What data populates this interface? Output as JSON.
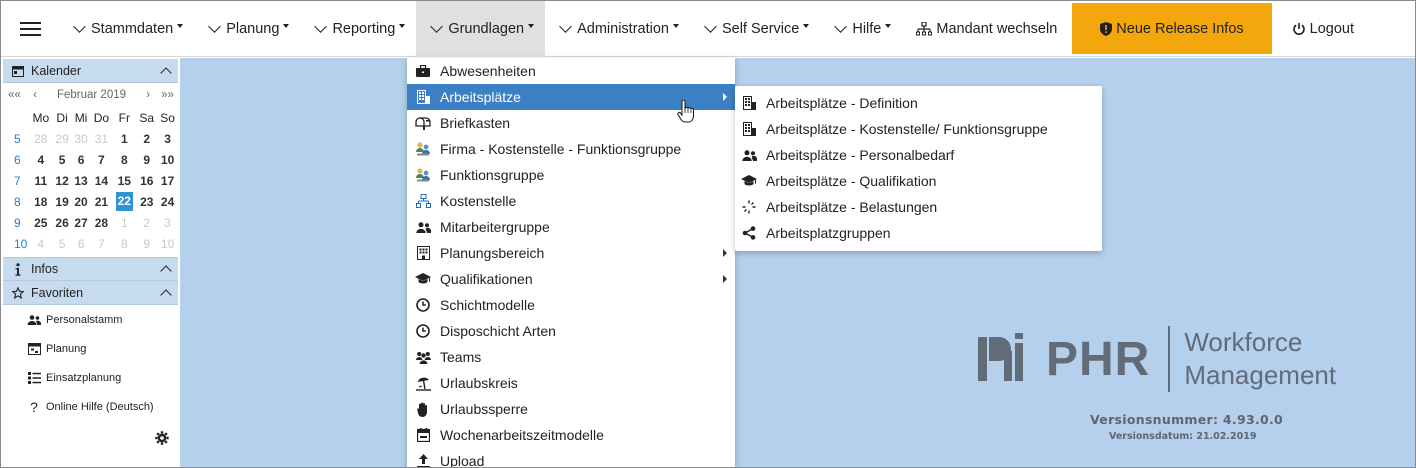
{
  "topnav": {
    "menu_icon": "hamburger-icon",
    "items": [
      {
        "label": "Stammdaten"
      },
      {
        "label": "Planung"
      },
      {
        "label": "Reporting"
      },
      {
        "label": "Grundlagen"
      },
      {
        "label": "Administration"
      },
      {
        "label": "Self Service"
      },
      {
        "label": "Hilfe"
      }
    ],
    "mandant": "Mandant wechseln",
    "release": "Neue Release Infos",
    "logout": "Logout"
  },
  "sidebar": {
    "calendar": {
      "title": "Kalender",
      "nav": {
        "first": "««",
        "prev": "‹",
        "month": "Februar 2019",
        "next": "›",
        "last": "»»"
      },
      "weekdays": [
        "Mo",
        "Di",
        "Mi",
        "Do",
        "Fr",
        "Sa",
        "So"
      ],
      "weeks": [
        {
          "wk": "5",
          "days": [
            "28",
            "29",
            "30",
            "31",
            "1",
            "2",
            "3"
          ],
          "other": [
            true,
            true,
            true,
            true,
            false,
            false,
            false
          ]
        },
        {
          "wk": "6",
          "days": [
            "4",
            "5",
            "6",
            "7",
            "8",
            "9",
            "10"
          ],
          "other": [
            false,
            false,
            false,
            false,
            false,
            false,
            false
          ]
        },
        {
          "wk": "7",
          "days": [
            "11",
            "12",
            "13",
            "14",
            "15",
            "16",
            "17"
          ],
          "other": [
            false,
            false,
            false,
            false,
            false,
            false,
            false
          ]
        },
        {
          "wk": "8",
          "days": [
            "18",
            "19",
            "20",
            "21",
            "22",
            "23",
            "24"
          ],
          "other": [
            false,
            false,
            false,
            false,
            false,
            false,
            false
          ]
        },
        {
          "wk": "9",
          "days": [
            "25",
            "26",
            "27",
            "28",
            "1",
            "2",
            "3"
          ],
          "other": [
            false,
            false,
            false,
            false,
            true,
            true,
            true
          ]
        },
        {
          "wk": "10",
          "days": [
            "4",
            "5",
            "6",
            "7",
            "8",
            "9",
            "10"
          ],
          "other": [
            true,
            true,
            true,
            true,
            true,
            true,
            true
          ]
        }
      ],
      "today": "22"
    },
    "infos": {
      "title": "Infos"
    },
    "favoriten": {
      "title": "Favoriten",
      "items": [
        {
          "label": "Personalstamm",
          "icon": "users-icon"
        },
        {
          "label": "Planung",
          "icon": "calendar-plan-icon"
        },
        {
          "label": "Einsatzplanung",
          "icon": "list-icon"
        },
        {
          "label": "Online Hilfe (Deutsch)",
          "icon": "question-icon"
        }
      ]
    }
  },
  "menu": {
    "items": [
      {
        "label": "Abwesenheiten",
        "icon": "briefcase-icon"
      },
      {
        "label": "Arbeitsplätze",
        "icon": "building-icon",
        "selected": true,
        "submenu": true
      },
      {
        "label": "Briefkasten",
        "icon": "mailbox-icon"
      },
      {
        "label": "Firma - Kostenstelle - Funktionsgruppe",
        "icon": "org-icon"
      },
      {
        "label": "Funktionsgruppe",
        "icon": "org-icon"
      },
      {
        "label": "Kostenstelle",
        "icon": "sitemap-icon"
      },
      {
        "label": "Mitarbeitergruppe",
        "icon": "users-icon"
      },
      {
        "label": "Planungsbereich",
        "icon": "building-alt-icon",
        "submenu": true
      },
      {
        "label": "Qualifikationen",
        "icon": "graduation-cap-icon",
        "submenu": true
      },
      {
        "label": "Schichtmodelle",
        "icon": "clock-icon"
      },
      {
        "label": "Disposchicht Arten",
        "icon": "clock-icon"
      },
      {
        "label": "Teams",
        "icon": "team-icon"
      },
      {
        "label": "Urlaubskreis",
        "icon": "beach-icon"
      },
      {
        "label": "Urlaubssperre",
        "icon": "hand-stop-icon"
      },
      {
        "label": "Wochenarbeitszeitmodelle",
        "icon": "calendar-week-icon"
      },
      {
        "label": "Upload",
        "icon": "upload-icon"
      }
    ]
  },
  "submenu": {
    "items": [
      {
        "label": "Arbeitsplätze - Definition",
        "icon": "building-icon"
      },
      {
        "label": "Arbeitsplätze - Kostenstelle/ Funktionsgruppe",
        "icon": "building-icon"
      },
      {
        "label": "Arbeitsplätze - Personalbedarf",
        "icon": "users-icon"
      },
      {
        "label": "Arbeitsplätze - Qualifikation",
        "icon": "graduation-cap-icon"
      },
      {
        "label": "Arbeitsplätze - Belastungen",
        "icon": "load-icon"
      },
      {
        "label": "Arbeitsplatzgruppen",
        "icon": "share-icon"
      }
    ]
  },
  "brand": {
    "name": "PHR",
    "line1": "Workforce",
    "line2": "Management",
    "version": "Versionsnummer: 4.93.0.0",
    "date": "Versionsdatum: 21.02.2019"
  },
  "colors": {
    "accent": "#3b7fc4",
    "release": "#f4a70c",
    "background": "#b5d0ec",
    "panel": "#c7dbef"
  }
}
